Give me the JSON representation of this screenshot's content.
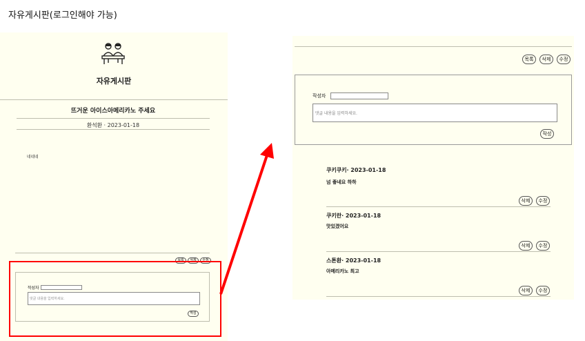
{
  "page_title": "자유게시판(로그인해야 가능)",
  "left": {
    "board_title": "자유게시판",
    "post_title": "뜨거운 아이스아메리카노 주세요",
    "post_meta": "환석환 · 2023-01-18",
    "post_body": "네네네",
    "buttons": {
      "list": "목록",
      "delete": "삭제",
      "edit": "수정",
      "submit": "작성"
    },
    "comment_form": {
      "author_label": "작성자",
      "placeholder": "댓글 내용을 입력하세요."
    }
  },
  "right": {
    "buttons": {
      "list": "목록",
      "delete": "삭제",
      "edit": "수정",
      "submit": "작성"
    },
    "comment_form": {
      "author_label": "작성자",
      "placeholder": "댓글 내용을 입력하세요."
    },
    "comments": [
      {
        "meta": "쿠키쿠키· 2023-01-18",
        "text": "넘 좋네요 하하",
        "delete": "삭제",
        "edit": "수정"
      },
      {
        "meta": "쿠키란· 2023-01-18",
        "text": "맛있겠어요",
        "delete": "삭제",
        "edit": "수정"
      },
      {
        "meta": "스톤환· 2023-01-18",
        "text": "아메리카노 최고",
        "delete": "삭제",
        "edit": "수정"
      }
    ]
  },
  "colors": {
    "panel_bg": "#fffff0",
    "highlight": "#ff0000"
  }
}
